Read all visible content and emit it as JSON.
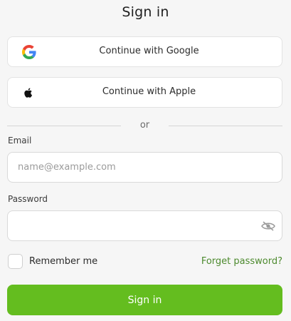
{
  "header": {
    "title": "Sign in"
  },
  "social": {
    "google": {
      "label": "Continue with Google",
      "icon": "google-icon"
    },
    "apple": {
      "label": "Continue with Apple",
      "icon": "apple-icon"
    }
  },
  "divider": {
    "text": "or"
  },
  "form": {
    "email": {
      "label": "Email",
      "placeholder": "name@example.com",
      "value": ""
    },
    "password": {
      "label": "Password",
      "placeholder": "",
      "value": "",
      "toggle_icon": "eye-hidden-icon"
    },
    "remember": {
      "label": "Remember me",
      "checked": false
    },
    "forgot_link": "Forget password?",
    "submit_label": "Sign in"
  },
  "colors": {
    "background": "#f6f6f6",
    "primary_button": "#64bd1f",
    "link": "#4d8a2e",
    "google_blue": "#4285F4",
    "google_red": "#EA4335",
    "google_yellow": "#FBBC05",
    "google_green": "#34A853"
  }
}
